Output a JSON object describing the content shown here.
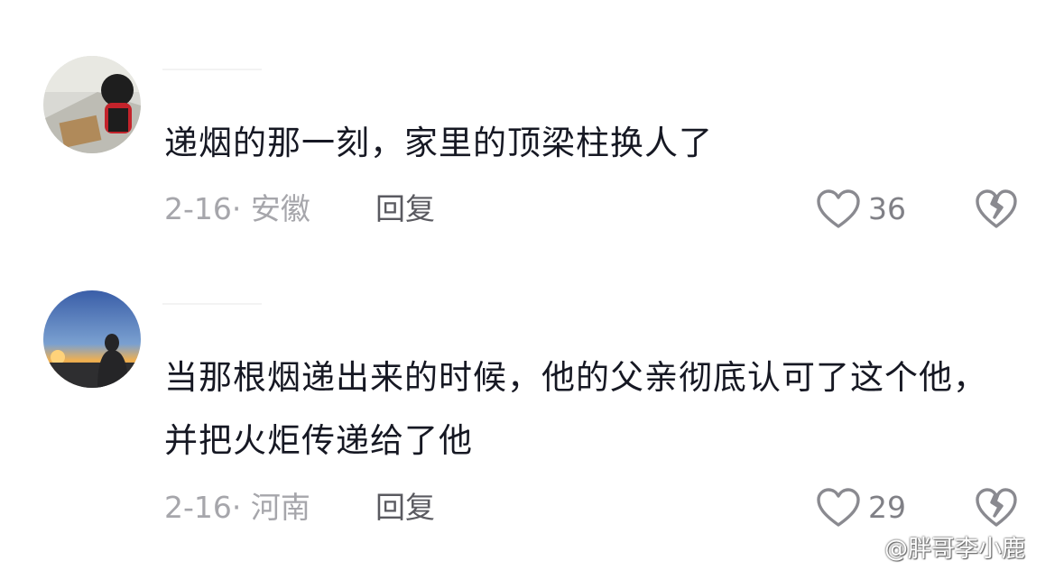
{
  "comments": [
    {
      "text": "递烟的那一刻，家里的顶梁柱换人了",
      "meta": "2-16· 安徽",
      "reply_label": "回复",
      "likes": "36",
      "avatar_icon": "user-avatar-photo-1"
    },
    {
      "text": "当那根烟递出来的时候，他的父亲彻底认可了这个他，并把火炬传递给了他",
      "meta": "2-16· 河南",
      "reply_label": "回复",
      "likes": "29",
      "avatar_icon": "user-avatar-photo-2"
    }
  ],
  "icons": {
    "like": "heart-outline-icon",
    "dislike": "broken-heart-icon",
    "watermark_logo": "weibo-logo-icon"
  },
  "watermark": {
    "text": "@胖哥李小鹿"
  },
  "colors": {
    "text": "#161823",
    "meta": "#a6a6ab",
    "reply": "#5a5a60",
    "icon": "#8a8a90"
  }
}
